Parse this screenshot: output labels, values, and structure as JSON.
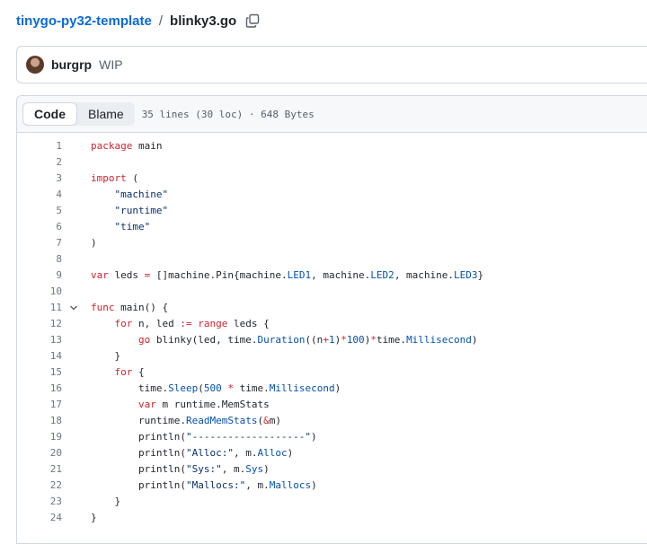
{
  "breadcrumb": {
    "repo": "tinygo-py32-template",
    "separator": "/",
    "file": "blinky3.go"
  },
  "commit": {
    "author": "burgrp",
    "message": "WIP"
  },
  "file_header": {
    "tabs": [
      "Code",
      "Blame"
    ],
    "active_tab": "Code",
    "info": "35 lines (30 loc) · 648 Bytes"
  },
  "code_lines": [
    {
      "n": "1",
      "fold": false,
      "tokens": [
        [
          "kw",
          "package"
        ],
        [
          "p",
          " main"
        ]
      ]
    },
    {
      "n": "2",
      "fold": false,
      "tokens": []
    },
    {
      "n": "3",
      "fold": false,
      "tokens": [
        [
          "kw",
          "import"
        ],
        [
          "p",
          " ("
        ]
      ]
    },
    {
      "n": "4",
      "fold": false,
      "tokens": [
        [
          "p",
          "    "
        ],
        [
          "str",
          "\"machine\""
        ]
      ]
    },
    {
      "n": "5",
      "fold": false,
      "tokens": [
        [
          "p",
          "    "
        ],
        [
          "str",
          "\"runtime\""
        ]
      ]
    },
    {
      "n": "6",
      "fold": false,
      "tokens": [
        [
          "p",
          "    "
        ],
        [
          "str",
          "\"time\""
        ]
      ]
    },
    {
      "n": "7",
      "fold": false,
      "tokens": [
        [
          "p",
          ")"
        ]
      ]
    },
    {
      "n": "8",
      "fold": false,
      "tokens": []
    },
    {
      "n": "9",
      "fold": false,
      "tokens": [
        [
          "kw",
          "var"
        ],
        [
          "p",
          " leds "
        ],
        [
          "kw",
          "="
        ],
        [
          "p",
          " []machine.Pin{machine."
        ],
        [
          "blue",
          "LED1"
        ],
        [
          "p",
          ", machine."
        ],
        [
          "blue",
          "LED2"
        ],
        [
          "p",
          ", machine."
        ],
        [
          "blue",
          "LED3"
        ],
        [
          "p",
          "}"
        ]
      ]
    },
    {
      "n": "10",
      "fold": false,
      "tokens": []
    },
    {
      "n": "11",
      "fold": true,
      "tokens": [
        [
          "kw",
          "func"
        ],
        [
          "p",
          " main() {"
        ]
      ]
    },
    {
      "n": "12",
      "fold": false,
      "tokens": [
        [
          "p",
          "    "
        ],
        [
          "kw",
          "for"
        ],
        [
          "p",
          " n, led "
        ],
        [
          "kw",
          ":="
        ],
        [
          "p",
          " "
        ],
        [
          "kw",
          "range"
        ],
        [
          "p",
          " leds {"
        ]
      ]
    },
    {
      "n": "13",
      "fold": false,
      "tokens": [
        [
          "p",
          "        "
        ],
        [
          "kw",
          "go"
        ],
        [
          "p",
          " blinky(led, time."
        ],
        [
          "blue",
          "Duration"
        ],
        [
          "p",
          "((n"
        ],
        [
          "kw",
          "+"
        ],
        [
          "blue",
          "1"
        ],
        [
          "p",
          ")"
        ],
        [
          "kw",
          "*"
        ],
        [
          "blue",
          "100"
        ],
        [
          "p",
          ")"
        ],
        [
          "kw",
          "*"
        ],
        [
          "p",
          "time."
        ],
        [
          "blue",
          "Millisecond"
        ],
        [
          "p",
          ")"
        ]
      ]
    },
    {
      "n": "14",
      "fold": false,
      "tokens": [
        [
          "p",
          "    }"
        ]
      ]
    },
    {
      "n": "15",
      "fold": false,
      "tokens": [
        [
          "p",
          "    "
        ],
        [
          "kw",
          "for"
        ],
        [
          "p",
          " {"
        ]
      ]
    },
    {
      "n": "16",
      "fold": false,
      "tokens": [
        [
          "p",
          "        time."
        ],
        [
          "blue",
          "Sleep"
        ],
        [
          "p",
          "("
        ],
        [
          "blue",
          "500"
        ],
        [
          "p",
          " "
        ],
        [
          "kw",
          "*"
        ],
        [
          "p",
          " time."
        ],
        [
          "blue",
          "Millisecond"
        ],
        [
          "p",
          ")"
        ]
      ]
    },
    {
      "n": "17",
      "fold": false,
      "tokens": [
        [
          "p",
          "        "
        ],
        [
          "kw",
          "var"
        ],
        [
          "p",
          " m runtime.MemStats"
        ]
      ]
    },
    {
      "n": "18",
      "fold": false,
      "tokens": [
        [
          "p",
          "        runtime."
        ],
        [
          "blue",
          "ReadMemStats"
        ],
        [
          "p",
          "("
        ],
        [
          "kw",
          "&"
        ],
        [
          "p",
          "m)"
        ]
      ]
    },
    {
      "n": "19",
      "fold": false,
      "tokens": [
        [
          "p",
          "        println("
        ],
        [
          "str",
          "\"-------------------\""
        ],
        [
          "p",
          ")"
        ]
      ]
    },
    {
      "n": "20",
      "fold": false,
      "tokens": [
        [
          "p",
          "        println("
        ],
        [
          "str",
          "\"Alloc:\""
        ],
        [
          "p",
          ", m."
        ],
        [
          "blue",
          "Alloc"
        ],
        [
          "p",
          ")"
        ]
      ]
    },
    {
      "n": "21",
      "fold": false,
      "tokens": [
        [
          "p",
          "        println("
        ],
        [
          "str",
          "\"Sys:\""
        ],
        [
          "p",
          ", m."
        ],
        [
          "blue",
          "Sys"
        ],
        [
          "p",
          ")"
        ]
      ]
    },
    {
      "n": "22",
      "fold": false,
      "tokens": [
        [
          "p",
          "        println("
        ],
        [
          "str",
          "\"Mallocs:\""
        ],
        [
          "p",
          ", m."
        ],
        [
          "blue",
          "Mallocs"
        ],
        [
          "p",
          ")"
        ]
      ]
    },
    {
      "n": "23",
      "fold": false,
      "tokens": [
        [
          "p",
          "    }"
        ]
      ]
    },
    {
      "n": "24",
      "fold": false,
      "tokens": [
        [
          "p",
          "}"
        ]
      ]
    }
  ],
  "colors": {
    "link": "#0969da",
    "keyword": "#cf222e",
    "string": "#0a3069",
    "constant": "#0550ae"
  },
  "icons": {
    "copy": "copy-icon",
    "fold": "chevron-down-icon"
  }
}
